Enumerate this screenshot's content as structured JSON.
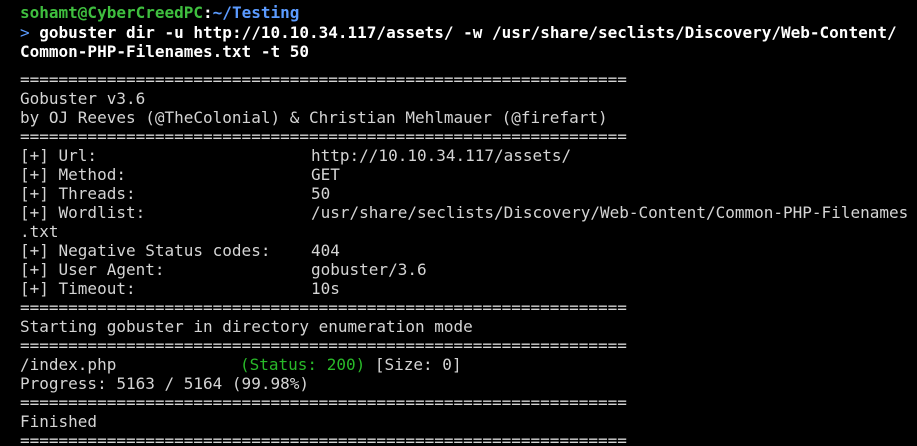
{
  "prompt": {
    "user_host": "sohamt@CyberCreedPC",
    "colon": ":",
    "path": "~/Testing",
    "arrow": ">",
    "command_line1": "gobuster dir -u http://10.10.34.117/assets/ -w /usr/share/seclists/Discovery/Web-Content/",
    "command_line2": "Common-PHP-Filenames.txt -t 50"
  },
  "separator": "===============================================================",
  "banner": {
    "version": "Gobuster v3.6",
    "authors": "by OJ Reeves (@TheColonial) & Christian Mehlmauer (@firefart)"
  },
  "config": [
    {
      "label": "[+] Url:",
      "value": "http://10.10.34.117/assets/"
    },
    {
      "label": "[+] Method:",
      "value": "GET"
    },
    {
      "label": "[+] Threads:",
      "value": "50"
    },
    {
      "label": "[+] Wordlist:",
      "value": "/usr/share/seclists/Discovery/Web-Content/Common-PHP-Filenames"
    },
    {
      "label": ".txt",
      "value": ""
    },
    {
      "label": "[+] Negative Status codes:",
      "value": "404"
    },
    {
      "label": "[+] User Agent:",
      "value": "gobuster/3.6"
    },
    {
      "label": "[+] Timeout:",
      "value": "10s"
    }
  ],
  "mode_line": "Starting gobuster in directory enumeration mode",
  "result": {
    "path": "/index.php",
    "status": "(Status: 200)",
    "size": "[Size: 0]"
  },
  "progress": "Progress: 5163 / 5164 (99.98%)",
  "finished": "Finished"
}
